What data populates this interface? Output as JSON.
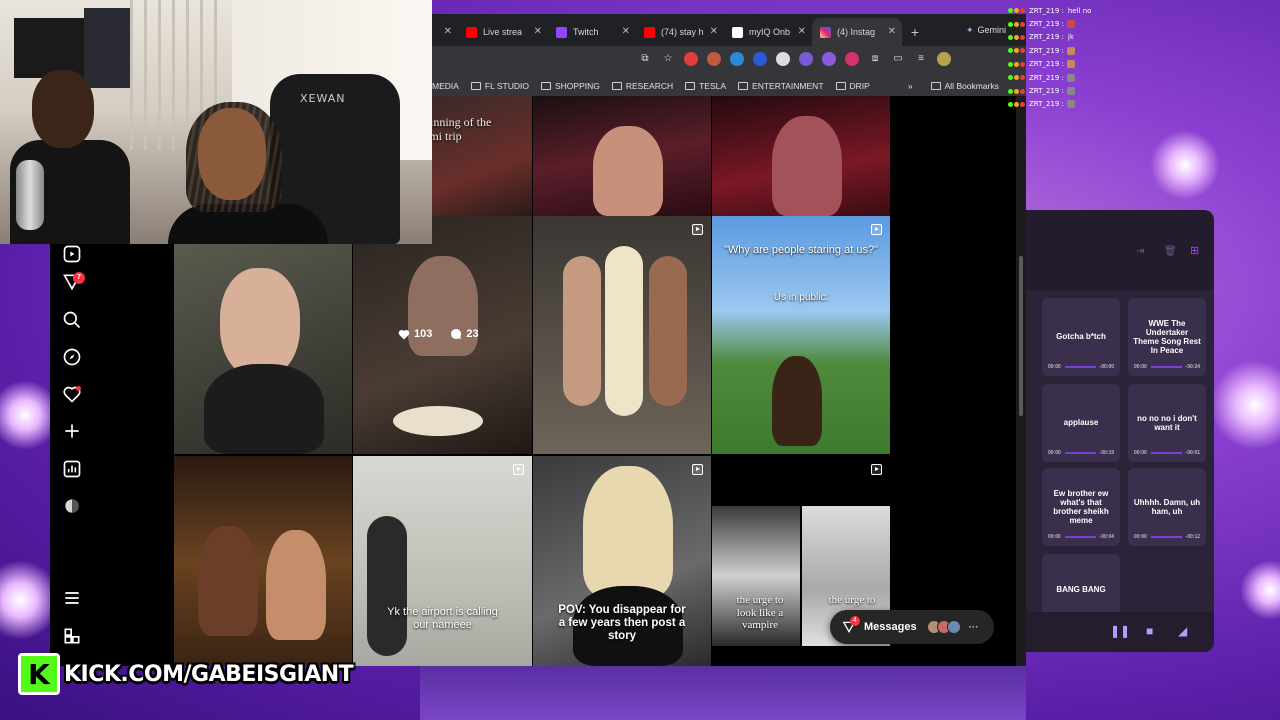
{
  "browser": {
    "tabs": [
      {
        "label": "",
        "color": "#ff0000",
        "active": false
      },
      {
        "label": "Live strea",
        "color": "#ff0000",
        "active": false
      },
      {
        "label": "Twitch",
        "color": "#9146ff",
        "active": false
      },
      {
        "label": "(74) stay h",
        "color": "#ff0000",
        "active": false
      },
      {
        "label": "myIQ Onb",
        "color": "#ffffff",
        "active": false
      },
      {
        "label": "(4) Instag",
        "color": "#e1306c",
        "active": true
      }
    ],
    "gemini_tab": "Gemini",
    "bookmarks": [
      "MEDIA",
      "FL STUDIO",
      "SHOPPING",
      "RESEARCH",
      "TESLA",
      "ENTERTAINMENT",
      "DRIP"
    ],
    "all_bookmarks": "All Bookmarks"
  },
  "instagram": {
    "notification_count": "7",
    "messages_label": "Messages",
    "messages_badge": "4",
    "posts": [
      {
        "caption": "ginning of the\nami trip"
      },
      {
        "caption": ""
      },
      {
        "caption": ""
      },
      {
        "caption": ""
      },
      {
        "caption": "",
        "likes": "103",
        "comments": "23"
      },
      {
        "caption": ""
      },
      {
        "caption": "\"Why are people staring at us?\"",
        "subcaption": "Us in public:"
      },
      {
        "caption": ""
      },
      {
        "caption": "Yk the airport is calling\nour nameee"
      },
      {
        "caption": "POV: You disappear for\na few years then post a\nstory"
      },
      {
        "caption_left": "the urge to\nlook like a\nvampire",
        "caption_right": "the urge to\nlook"
      }
    ]
  },
  "soundboard": {
    "buttons": [
      {
        "title": "Gotcha b*tch",
        "start": "00:00",
        "end": "-00:00"
      },
      {
        "title": "WWE The Undertaker Theme Song Rest In Peace",
        "start": "00:00",
        "end": "-00:24"
      },
      {
        "title": "applause",
        "start": "00:00",
        "end": "-00:19"
      },
      {
        "title": "no no no i don't want it",
        "start": "00:00",
        "end": "-00:01"
      },
      {
        "title": "Ew brother ew what's that brother sheikh meme",
        "start": "00:00",
        "end": "-00:04"
      },
      {
        "title": "Uhhhh. Damn, uh ham, uh",
        "start": "00:00",
        "end": "-00:12"
      },
      {
        "title": "BANG BANG",
        "start": "",
        "end": ""
      }
    ]
  },
  "chat": [
    {
      "user": "ZRT_219 :",
      "text": "hell no"
    },
    {
      "user": "ZRT_219 :",
      "text": ""
    },
    {
      "user": "ZRT_219 :",
      "text": "jk"
    },
    {
      "user": "ZRT_219 :",
      "text": ""
    },
    {
      "user": "ZRT_219 :",
      "text": ""
    },
    {
      "user": "ZRT_219 :",
      "text": ""
    },
    {
      "user": "ZRT_219 :",
      "text": ""
    },
    {
      "user": "ZRT_219 :",
      "text": ""
    }
  ],
  "overlay": {
    "kick_url": "KICK.COM/GABEISGIANT",
    "kick_logo": "K",
    "chair_brand": "XEWAN"
  }
}
